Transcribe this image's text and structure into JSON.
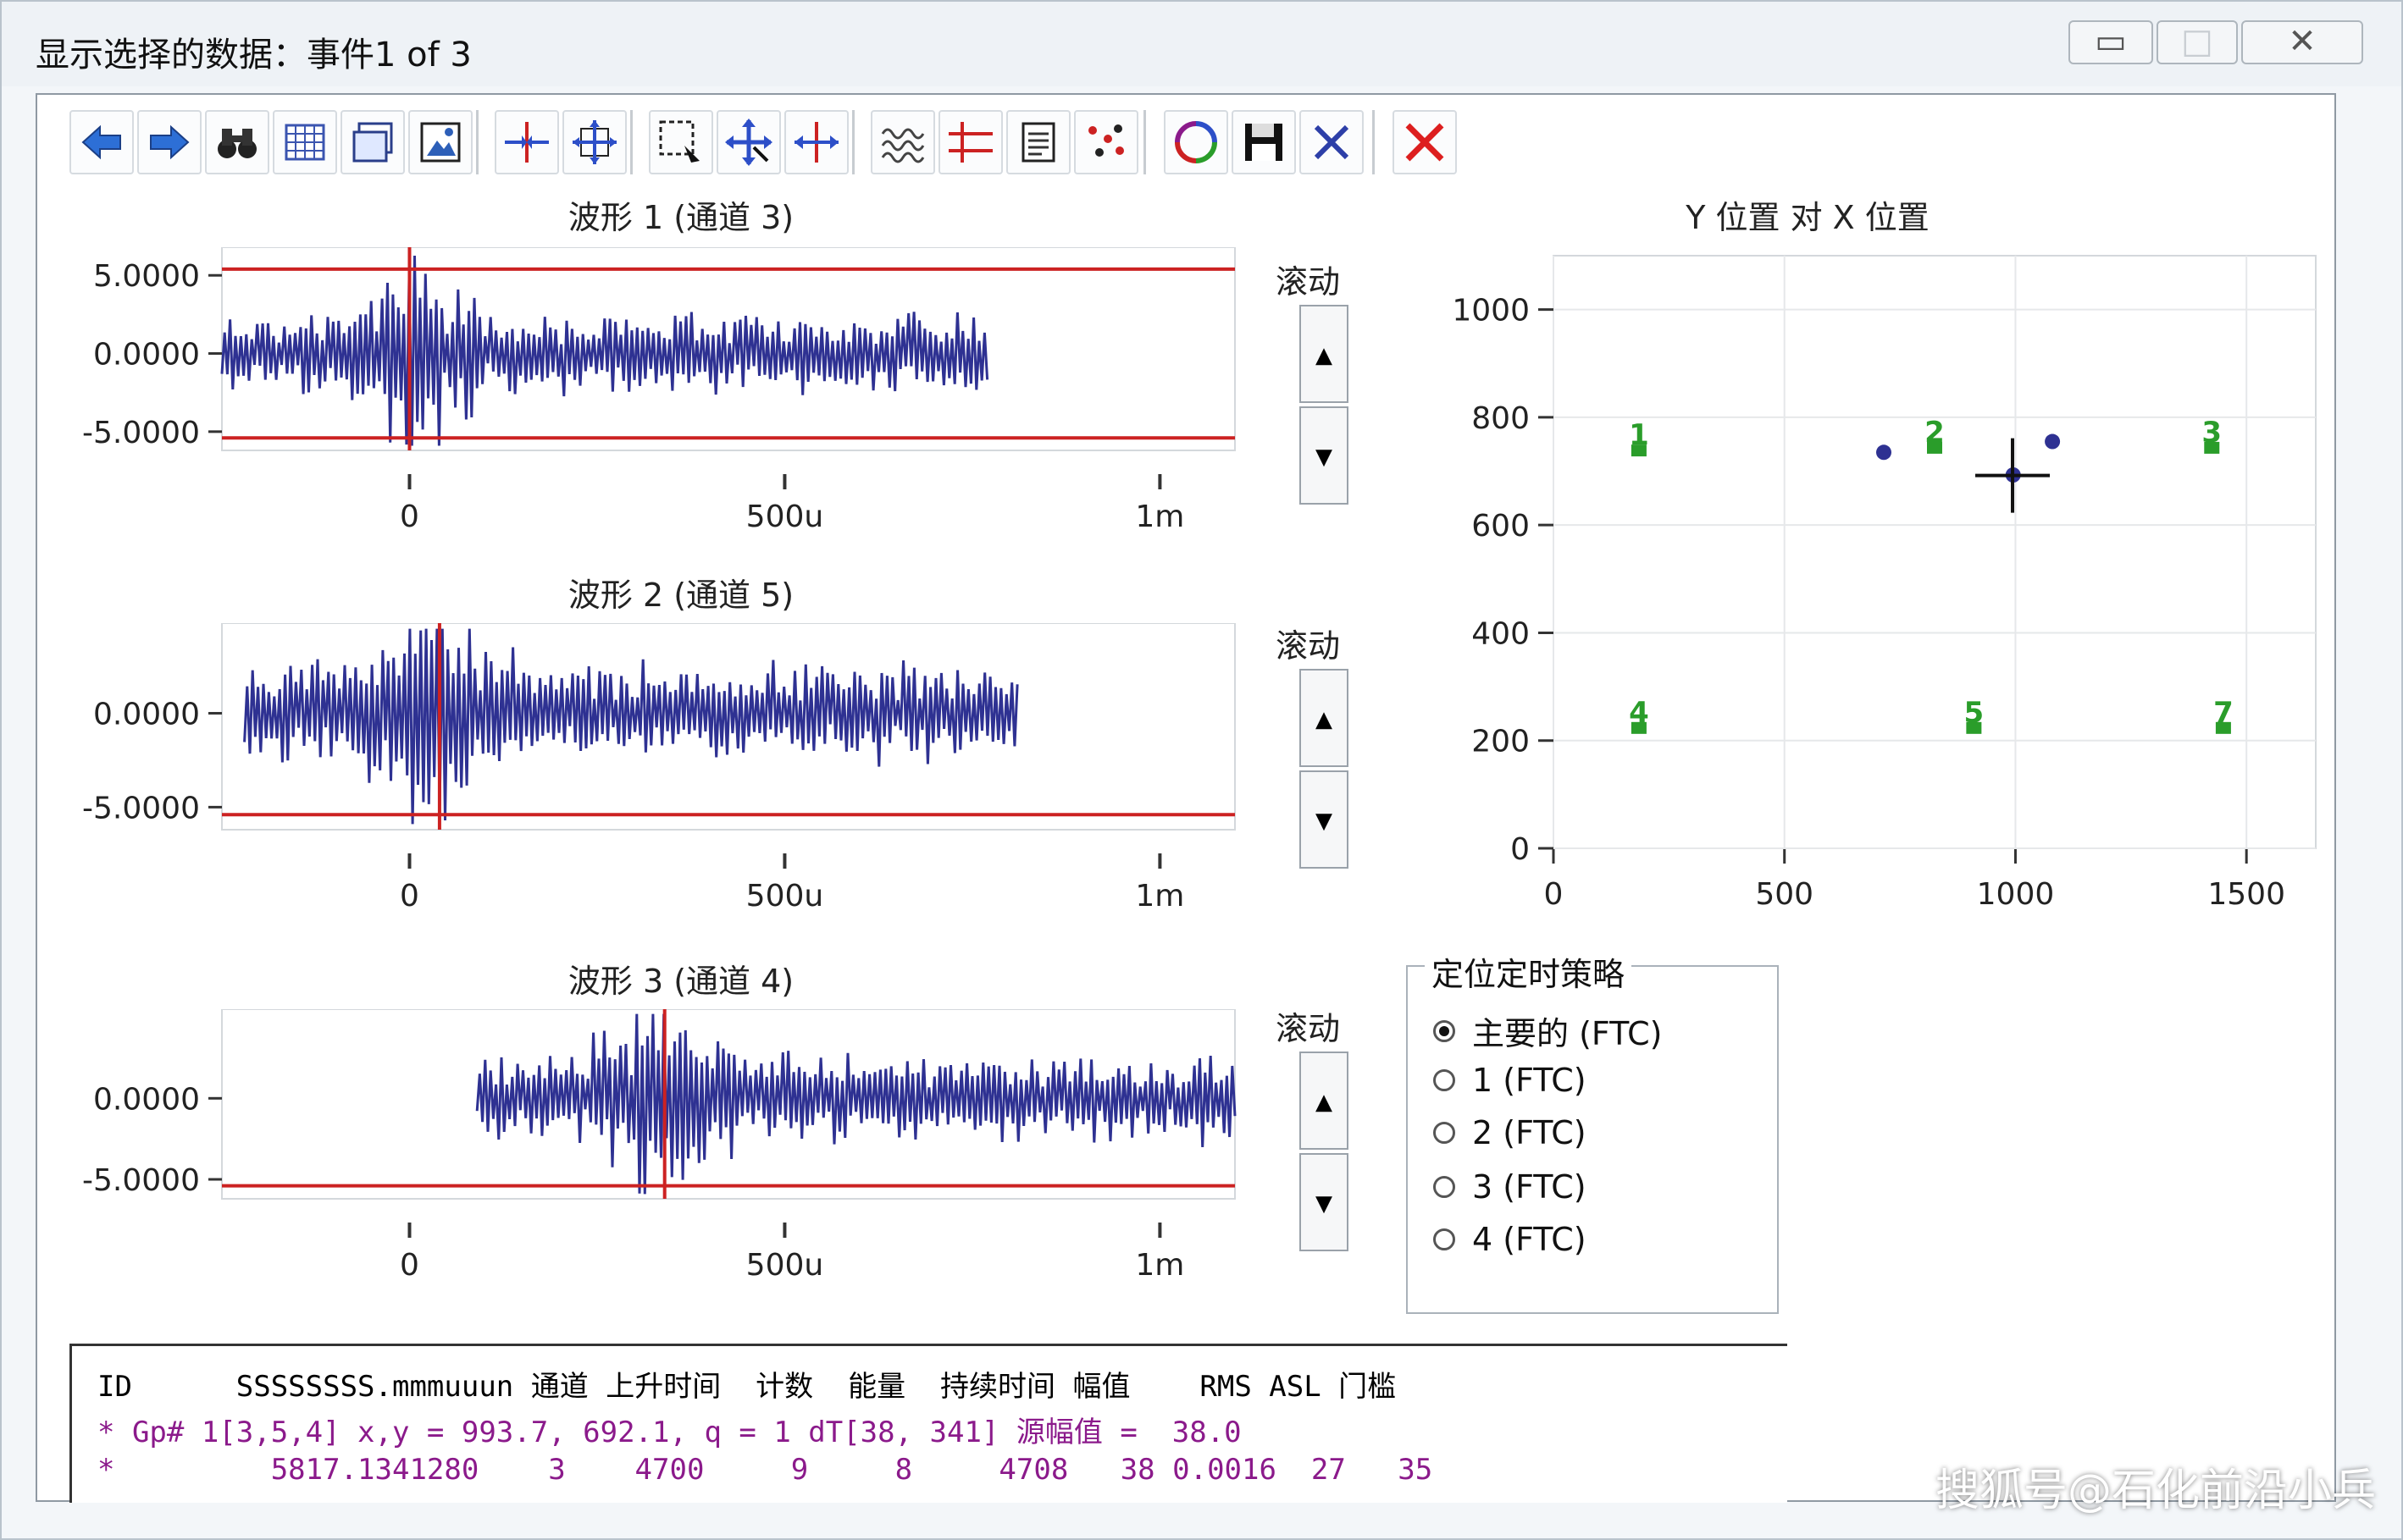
{
  "window": {
    "title": "显示选择的数据：事件1 of 3",
    "min_glyph": "▭",
    "max_glyph": "□",
    "close_glyph": "✕"
  },
  "toolbar": {
    "buttons": [
      {
        "name": "back-arrow-icon"
      },
      {
        "name": "forward-arrow-icon"
      },
      {
        "name": "binoculars-icon"
      },
      {
        "name": "grid-icon"
      },
      {
        "name": "window-copy-icon"
      },
      {
        "name": "image-icon"
      },
      {
        "name": "cursor-horizontal-icon"
      },
      {
        "name": "move-all-icon"
      },
      {
        "name": "zoom-select-icon"
      },
      {
        "name": "pan-icon"
      },
      {
        "name": "expand-horizontal-icon"
      },
      {
        "name": "waveform-icon"
      },
      {
        "name": "threshold-lines-icon"
      },
      {
        "name": "notes-icon"
      },
      {
        "name": "scatter-icon"
      },
      {
        "name": "recycle-icon"
      },
      {
        "name": "save-icon"
      },
      {
        "name": "blue-x-icon"
      },
      {
        "name": "red-x-icon"
      }
    ]
  },
  "waveforms": [
    {
      "title": "波形 1 (通道 3)",
      "scroll_label": "滚动",
      "up": "▲",
      "down": "▼",
      "yticks": [
        "5.0000",
        "0.0000",
        "-5.0000"
      ],
      "xticks": [
        "0",
        "500u",
        "1m"
      ]
    },
    {
      "title": "波形 2 (通道 5)",
      "scroll_label": "滚动",
      "up": "▲",
      "down": "▼",
      "yticks": [
        "0.0000",
        "-5.0000"
      ],
      "xticks": [
        "0",
        "500u",
        "1m"
      ]
    },
    {
      "title": "波形 3 (通道 4)",
      "scroll_label": "滚动",
      "up": "▲",
      "down": "▼",
      "yticks": [
        "0.0000",
        "-5.0000"
      ],
      "xticks": [
        "0",
        "500u",
        "1m"
      ]
    }
  ],
  "chart_data": [
    {
      "type": "line",
      "title": "波形 1 (通道 3)",
      "xlabel": "",
      "ylabel": "",
      "xlim": [
        -0.00025,
        0.0011
      ],
      "ylim": [
        -6.2,
        6.8
      ],
      "threshold": [
        5.4,
        -5.4
      ],
      "cursor_x": 0,
      "signal_range": [
        -0.00025,
        0.00077
      ],
      "colors": {
        "signal": "#2e3192",
        "threshold": "#cc2222"
      },
      "grid": false
    },
    {
      "type": "line",
      "title": "波形 2 (通道 5)",
      "xlabel": "",
      "ylabel": "",
      "xlim": [
        -0.00025,
        0.0011
      ],
      "ylim": [
        -6.2,
        4.8
      ],
      "threshold": [
        -5.4
      ],
      "cursor_x": 4e-05,
      "signal_range": [
        -0.00022,
        0.00081
      ],
      "colors": {
        "signal": "#2e3192",
        "threshold": "#cc2222"
      },
      "grid": false
    },
    {
      "type": "line",
      "title": "波形 3 (通道 4)",
      "xlabel": "",
      "ylabel": "",
      "xlim": [
        -0.00025,
        0.0011
      ],
      "ylim": [
        -6.2,
        5.5
      ],
      "threshold": [
        -5.4
      ],
      "cursor_x": 0.00034,
      "signal_range": [
        9e-05,
        0.0011
      ],
      "colors": {
        "signal": "#2e3192",
        "threshold": "#cc2222"
      },
      "grid": false
    },
    {
      "type": "scatter",
      "title": "Y 位置 对 X 位置",
      "xlabel": "",
      "ylabel": "",
      "xlim": [
        0,
        1650
      ],
      "ylim": [
        0,
        1100
      ],
      "xticks": [
        "0",
        "500",
        "1000",
        "1500"
      ],
      "yticks": [
        "0",
        "200",
        "400",
        "600",
        "800",
        "1000"
      ],
      "sensors": [
        {
          "label": "1",
          "x": 185,
          "y": 740
        },
        {
          "label": "2",
          "x": 825,
          "y": 745
        },
        {
          "label": "3",
          "x": 1425,
          "y": 745
        },
        {
          "label": "4",
          "x": 185,
          "y": 225
        },
        {
          "label": "5",
          "x": 910,
          "y": 225
        },
        {
          "label": "7",
          "x": 1450,
          "y": 225
        }
      ],
      "events": [
        {
          "x": 715,
          "y": 735
        },
        {
          "x": 1080,
          "y": 755
        },
        {
          "x": 995,
          "y": 693
        }
      ],
      "cross_marker": {
        "x": 993.7,
        "y": 692.1
      },
      "colors": {
        "sensor": "#2a9d2a",
        "event": "#2e3192"
      },
      "grid": true
    }
  ],
  "strategy": {
    "title": "定位定时策略",
    "options": [
      {
        "label": "主要的 (FTC)",
        "selected": true
      },
      {
        "label": "1  (FTC)",
        "selected": false
      },
      {
        "label": "2  (FTC)",
        "selected": false
      },
      {
        "label": "3  (FTC)",
        "selected": false
      },
      {
        "label": "4  (FTC)",
        "selected": false
      }
    ]
  },
  "log": {
    "header": "ID      SSSSSSSS.mmmuuun 通道 上升时间  计数  能量  持续时间 幅值    RMS ASL 门槛",
    "line1": "* Gp# 1[3,5,4] x,y = 993.7, 692.1, q = 1 dT[38, 341] 源幅值 =  38.0",
    "line2": "*         5817.1341280    3    4700     9     8     4708   38 0.0016  27   35",
    "colors": {
      "header": "#111111",
      "data": "#8b1a8b"
    }
  },
  "watermark": "搜狐号@石化前沿小兵"
}
